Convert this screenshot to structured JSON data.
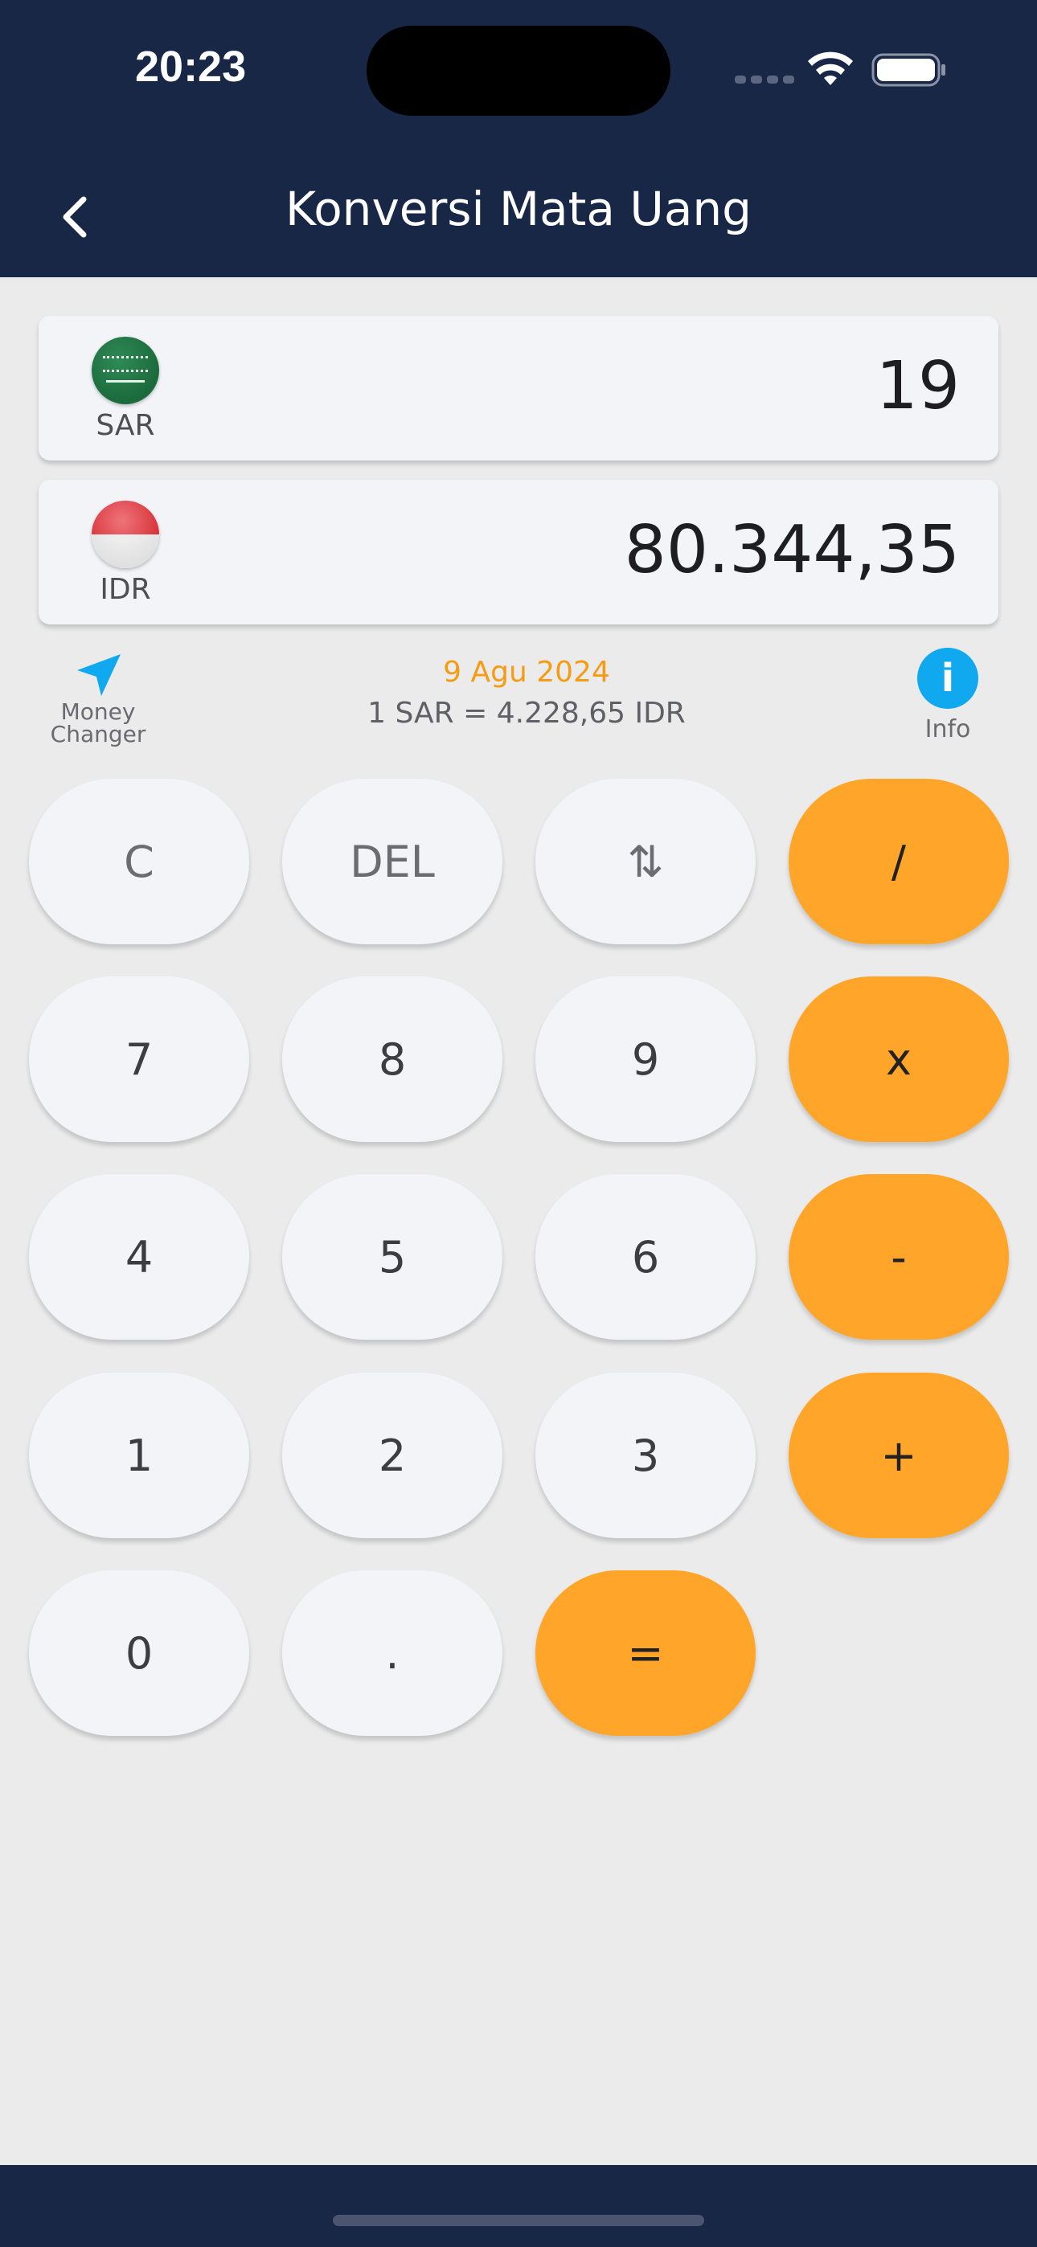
{
  "status_bar": {
    "time": "20:23"
  },
  "header": {
    "title": "Konversi Mata Uang"
  },
  "from_currency": {
    "code": "SAR",
    "amount": "19",
    "flag": "saudi-arabia-flag"
  },
  "to_currency": {
    "code": "IDR",
    "amount": "80.344,35",
    "flag": "indonesia-flag"
  },
  "info_row": {
    "money_changer_line1": "Money",
    "money_changer_line2": "Changer",
    "date": "9 Agu 2024",
    "rate": "1 SAR = 4.228,65 IDR",
    "info_glyph": "i",
    "info_label": "Info"
  },
  "keypad": {
    "clear": "C",
    "delete": "DEL",
    "swap": "⇅",
    "divide": "/",
    "seven": "7",
    "eight": "8",
    "nine": "9",
    "multiply": "x",
    "four": "4",
    "five": "5",
    "six": "6",
    "minus": "-",
    "one": "1",
    "two": "2",
    "three": "3",
    "plus": "+",
    "zero": "0",
    "decimal": ".",
    "equals": "="
  },
  "colors": {
    "navy": "#182745",
    "accent_orange": "#ffa62a",
    "date_orange": "#f59b14",
    "info_blue": "#10a9ef",
    "key_bg": "#f3f4f8"
  }
}
